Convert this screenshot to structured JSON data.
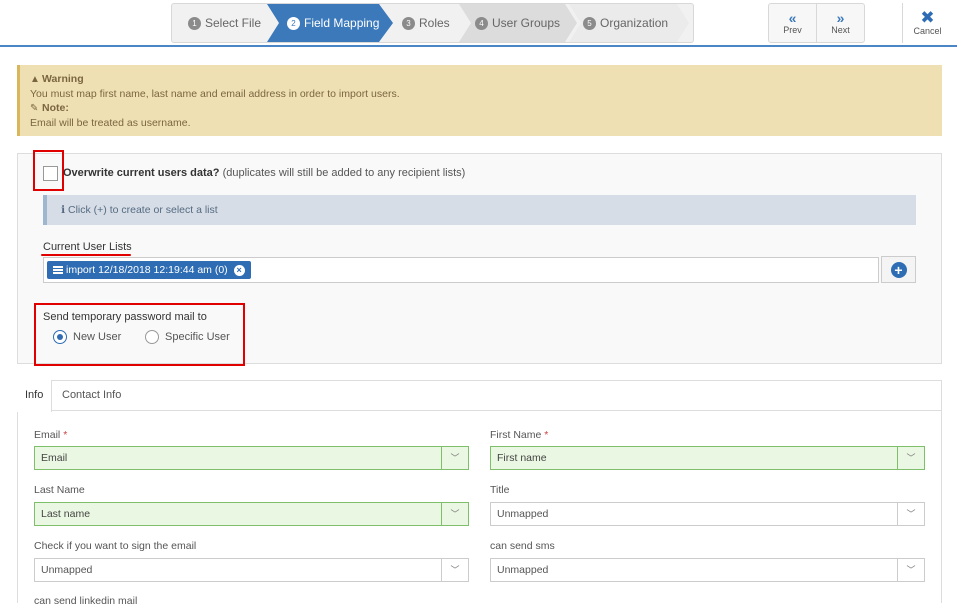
{
  "wizard": {
    "steps": [
      {
        "num": "1",
        "label": "Select File"
      },
      {
        "num": "2",
        "label": "Field Mapping"
      },
      {
        "num": "3",
        "label": "Roles"
      },
      {
        "num": "4",
        "label": "User Groups"
      },
      {
        "num": "5",
        "label": "Organization"
      }
    ],
    "active_step": 2,
    "prev_label": "Prev",
    "next_label": "Next",
    "cancel_label": "Cancel"
  },
  "warning": {
    "title": "Warning",
    "message": "You must map first name, last name and email address in order to import users.",
    "note_title": "Note:",
    "note_text": "Email will be treated as username."
  },
  "options": {
    "overwrite_label": "Overwrite current users data?",
    "overwrite_hint": "(duplicates will still be added to any recipient lists)",
    "overwrite_checked": false,
    "info_text": "Click (+) to create or select a list",
    "lists_label": "Current User Lists",
    "list_tags": [
      "import 12/18/2018 12:19:44 am (0)"
    ],
    "password_label": "Send temporary password mail to",
    "radio_new_user": "New User",
    "radio_specific_user": "Specific User",
    "selected_radio": "New User"
  },
  "tabs": [
    {
      "label": "Info",
      "active": true
    },
    {
      "label": "Contact Info",
      "active": false
    }
  ],
  "fields": {
    "email": {
      "label": "Email",
      "required_mark": "*",
      "value": "Email"
    },
    "first_name": {
      "label": "First Name",
      "required_mark": "*",
      "value": "First name"
    },
    "last_name": {
      "label": "Last Name",
      "value": "Last name"
    },
    "title": {
      "label": "Title",
      "value": "Unmapped"
    },
    "sign_email": {
      "label": "Check if you want to sign the email",
      "value": "Unmapped"
    },
    "can_send_sms": {
      "label": "can send sms",
      "value": "Unmapped"
    },
    "linkedin": {
      "label": "can send linkedin mail"
    }
  },
  "colors": {
    "accent": "#2e6db4",
    "warning_bg": "#efe0b4",
    "mapped_bg": "#eaf7e2",
    "highlight_red": "#e00000"
  }
}
